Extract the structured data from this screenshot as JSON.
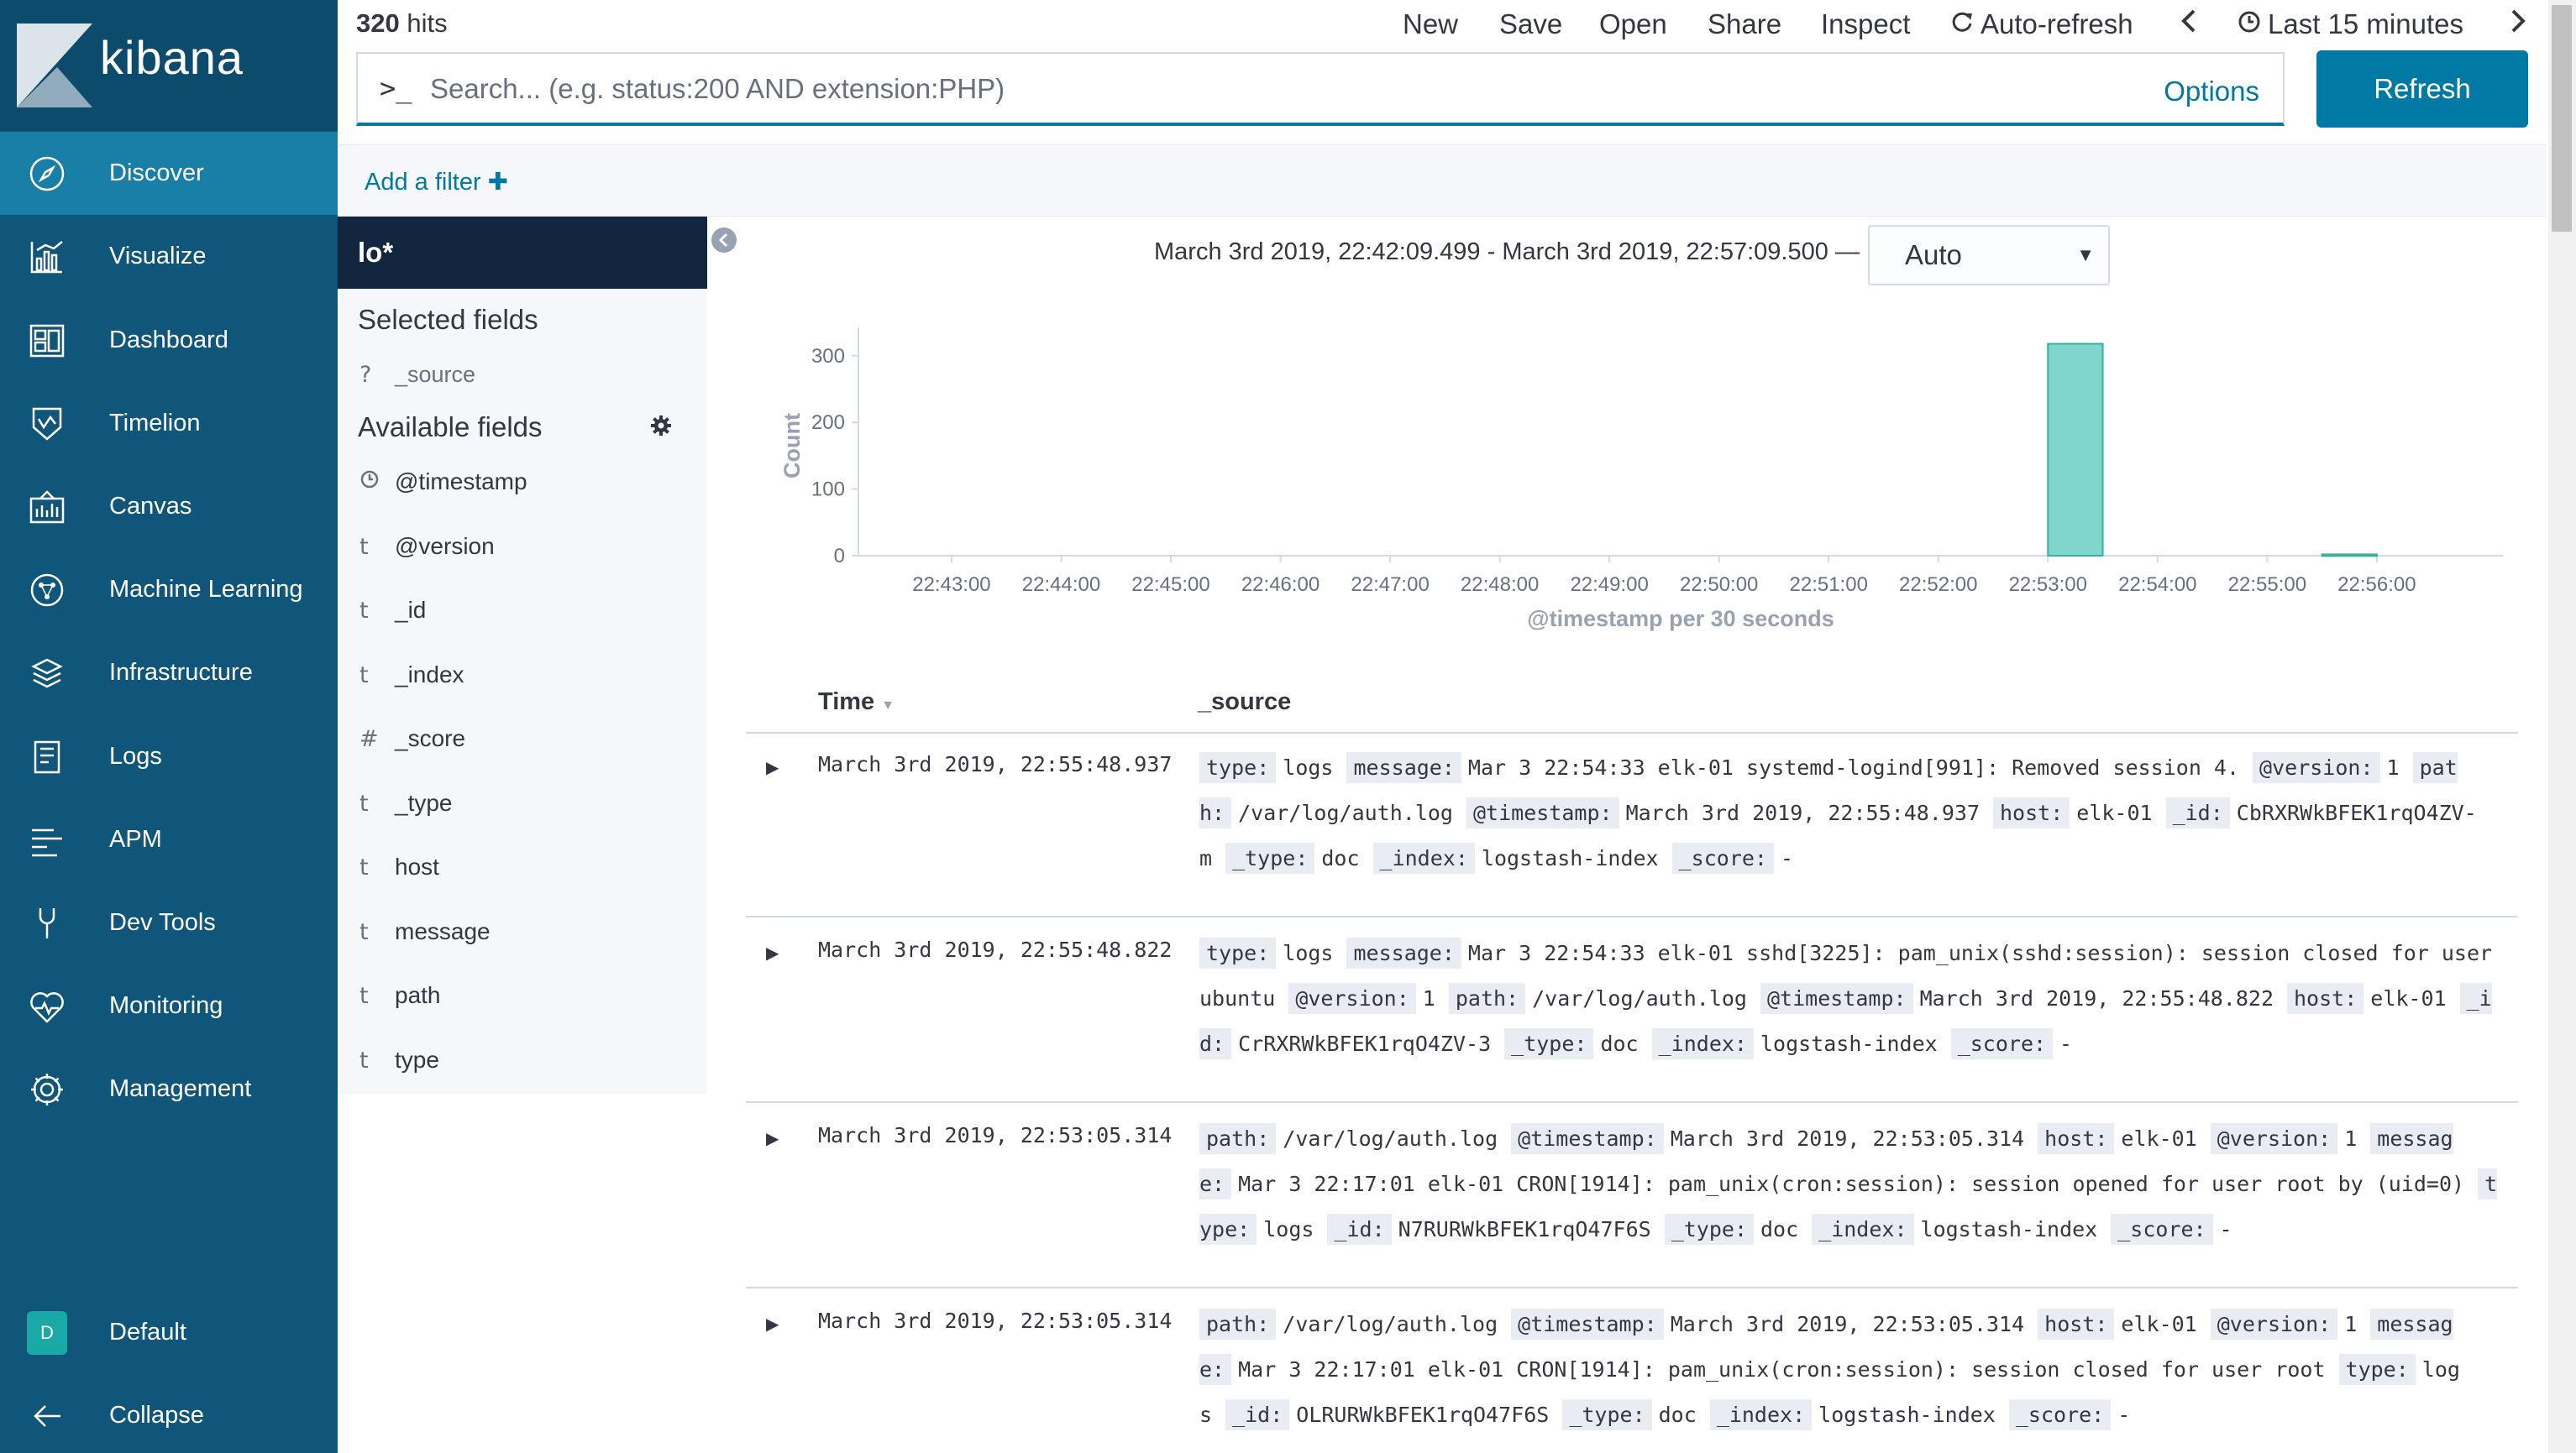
{
  "app": {
    "brand": "kibana"
  },
  "nav": {
    "items": [
      {
        "label": "Discover",
        "icon": "compass-icon"
      },
      {
        "label": "Visualize",
        "icon": "visualize-icon"
      },
      {
        "label": "Dashboard",
        "icon": "dashboard-icon"
      },
      {
        "label": "Timelion",
        "icon": "timelion-icon"
      },
      {
        "label": "Canvas",
        "icon": "canvas-icon"
      },
      {
        "label": "Machine Learning",
        "icon": "machine-learning-icon"
      },
      {
        "label": "Infrastructure",
        "icon": "infrastructure-icon"
      },
      {
        "label": "Logs",
        "icon": "logs-icon"
      },
      {
        "label": "APM",
        "icon": "apm-icon"
      },
      {
        "label": "Dev Tools",
        "icon": "dev-tools-icon"
      },
      {
        "label": "Monitoring",
        "icon": "monitoring-icon"
      },
      {
        "label": "Management",
        "icon": "gear-icon"
      }
    ],
    "space": {
      "avatar": "D",
      "label": "Default"
    },
    "collapse_label": "Collapse"
  },
  "topbar": {
    "hits_count": "320",
    "hits_label": "hits",
    "menu": [
      "New",
      "Save",
      "Open",
      "Share",
      "Inspect"
    ],
    "auto_refresh": "Auto-refresh",
    "time_range": "Last 15 minutes"
  },
  "search": {
    "prompt": ">_",
    "placeholder": "Search... (e.g. status:200 AND extension:PHP)",
    "value": "",
    "options_label": "Options",
    "refresh_label": "Refresh"
  },
  "filters": {
    "add_label": "Add a filter"
  },
  "fields": {
    "index_pattern": "lo*",
    "selected_title": "Selected fields",
    "selected": [
      {
        "type": "?",
        "name": "_source"
      }
    ],
    "available_title": "Available fields",
    "available": [
      {
        "type": "clock",
        "name": "@timestamp"
      },
      {
        "type": "t",
        "name": "@version"
      },
      {
        "type": "t",
        "name": "_id"
      },
      {
        "type": "t",
        "name": "_index"
      },
      {
        "type": "#",
        "name": "_score"
      },
      {
        "type": "t",
        "name": "_type"
      },
      {
        "type": "t",
        "name": "host"
      },
      {
        "type": "t",
        "name": "message"
      },
      {
        "type": "t",
        "name": "path"
      },
      {
        "type": "t",
        "name": "type"
      }
    ]
  },
  "histogram": {
    "range_text": "March 3rd 2019, 22:42:09.499 - March 3rd 2019, 22:57:09.500 —",
    "interval": "Auto"
  },
  "chart_data": {
    "type": "bar",
    "xlabel": "@timestamp per 30 seconds",
    "ylabel": "Count",
    "ylim": [
      0,
      330
    ],
    "yticks": [
      0,
      100,
      200,
      300
    ],
    "x_tick_labels": [
      "22:43:00",
      "22:44:00",
      "22:45:00",
      "22:46:00",
      "22:47:00",
      "22:48:00",
      "22:49:00",
      "22:50:00",
      "22:51:00",
      "22:52:00",
      "22:53:00",
      "22:54:00",
      "22:55:00",
      "22:56:00"
    ],
    "x_domain_minutes": [
      42.15,
      57.15
    ],
    "bars": [
      {
        "x": "22:53:00",
        "x_minutes": 53.0,
        "value": 318
      },
      {
        "x": "22:55:30",
        "x_minutes": 55.5,
        "value": 2
      }
    ],
    "bar_color": "#7fd6cd",
    "grid": false
  },
  "table": {
    "col_time": "Time",
    "col_source": "_source",
    "rows": [
      {
        "time": "March 3rd 2019, 22:55:48.937",
        "fields": [
          {
            "k": "type:",
            "v": "logs"
          },
          {
            "k": "message:",
            "v": "Mar 3 22:54:33 elk-01 systemd-logind[991]: Removed session 4."
          },
          {
            "k": "@version:",
            "v": "1"
          },
          {
            "k": "path:",
            "v": "/var/log/auth.log"
          },
          {
            "k": "@timestamp:",
            "v": "March 3rd 2019, 22:55:48.937"
          },
          {
            "k": "host:",
            "v": "elk-01"
          },
          {
            "k": "_id:",
            "v": "CbRXRWkBFEK1rqO4ZV-m"
          },
          {
            "k": "_type:",
            "v": "doc"
          },
          {
            "k": "_index:",
            "v": "logstash-index"
          },
          {
            "k": "_score:",
            "v": "-"
          }
        ]
      },
      {
        "time": "March 3rd 2019, 22:55:48.822",
        "fields": [
          {
            "k": "type:",
            "v": "logs"
          },
          {
            "k": "message:",
            "v": "Mar 3 22:54:33 elk-01 sshd[3225]: pam_unix(sshd:session): session closed for user ubuntu"
          },
          {
            "k": "@version:",
            "v": "1"
          },
          {
            "k": "path:",
            "v": "/var/log/auth.log"
          },
          {
            "k": "@timestamp:",
            "v": "March 3rd 2019, 22:55:48.822"
          },
          {
            "k": "host:",
            "v": "elk-01"
          },
          {
            "k": "_id:",
            "v": "CrRXRWkBFEK1rqO4ZV-3"
          },
          {
            "k": "_type:",
            "v": "doc"
          },
          {
            "k": "_index:",
            "v": "logstash-index"
          },
          {
            "k": "_score:",
            "v": "-"
          }
        ]
      },
      {
        "time": "March 3rd 2019, 22:53:05.314",
        "fields": [
          {
            "k": "path:",
            "v": "/var/log/auth.log"
          },
          {
            "k": "@timestamp:",
            "v": "March 3rd 2019, 22:53:05.314"
          },
          {
            "k": "host:",
            "v": "elk-01"
          },
          {
            "k": "@version:",
            "v": "1"
          },
          {
            "k": "message:",
            "v": "Mar 3 22:17:01 elk-01 CRON[1914]: pam_unix(cron:session): session opened for user root by (uid=0)"
          },
          {
            "k": "type:",
            "v": "logs"
          },
          {
            "k": "_id:",
            "v": "N7RURWkBFEK1rqO47F6S"
          },
          {
            "k": "_type:",
            "v": "doc"
          },
          {
            "k": "_index:",
            "v": "logstash-index"
          },
          {
            "k": "_score:",
            "v": "-"
          }
        ]
      },
      {
        "time": "March 3rd 2019, 22:53:05.314",
        "fields": [
          {
            "k": "path:",
            "v": "/var/log/auth.log"
          },
          {
            "k": "@timestamp:",
            "v": "March 3rd 2019, 22:53:05.314"
          },
          {
            "k": "host:",
            "v": "elk-01"
          },
          {
            "k": "@version:",
            "v": "1"
          },
          {
            "k": "message:",
            "v": "Mar 3 22:17:01 elk-01 CRON[1914]: pam_unix(cron:session): session closed for user root"
          },
          {
            "k": "type:",
            "v": "logs"
          },
          {
            "k": "_id:",
            "v": "OLRURWkBFEK1rqO47F6S"
          },
          {
            "k": "_type:",
            "v": "doc"
          },
          {
            "k": "_index:",
            "v": "logstash-index"
          },
          {
            "k": "_score:",
            "v": "-"
          }
        ]
      }
    ]
  }
}
